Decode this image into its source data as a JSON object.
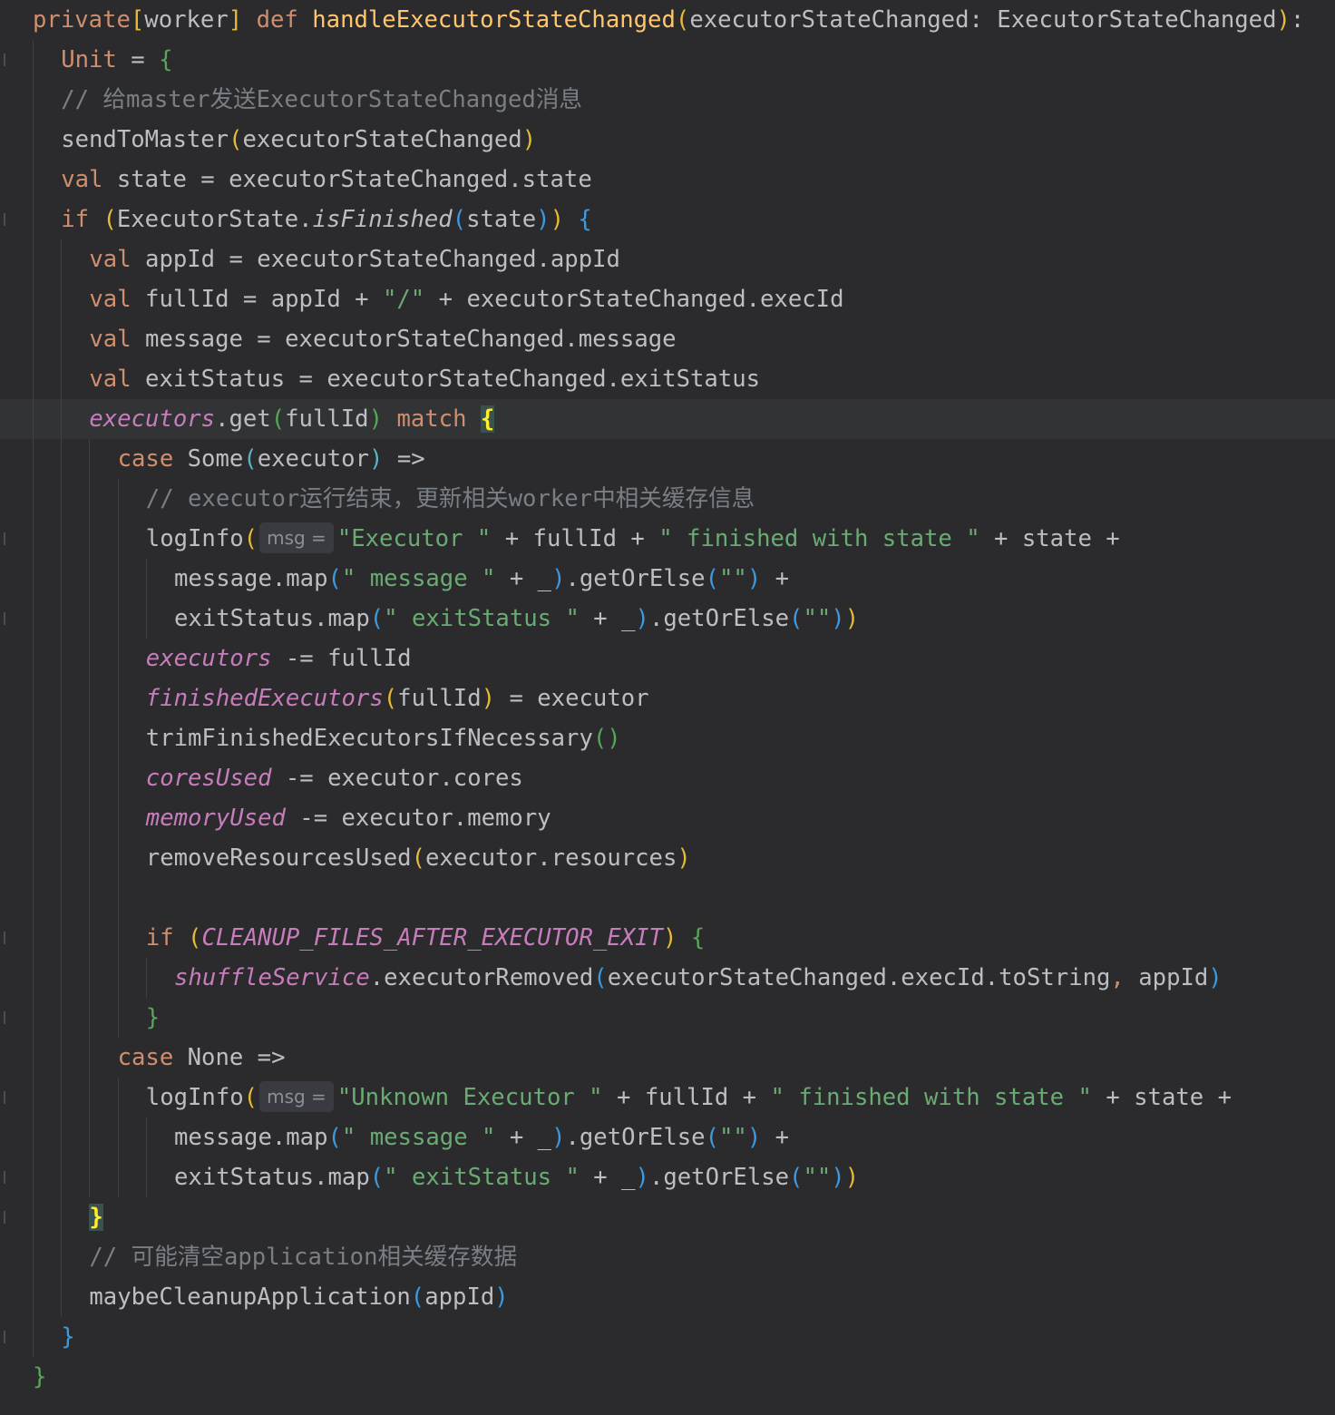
{
  "editor": {
    "colors": {
      "background": "#2b2b2d",
      "keyword": "#cf8e6d",
      "function_def": "#ffc66d",
      "function_call": "#56a8f5",
      "string": "#6aab73",
      "comment": "#7a7e85",
      "field": "#c77dbb",
      "default_text": "#bcbec4"
    },
    "lines": [
      {
        "indent": 1,
        "tokens": [
          [
            "kw",
            "private"
          ],
          [
            "br-y",
            "["
          ],
          [
            "plain",
            "worker"
          ],
          [
            "br-y",
            "]"
          ],
          [
            "plain",
            " "
          ],
          [
            "kw",
            "def"
          ],
          [
            "plain",
            " "
          ],
          [
            "fndef",
            "handleExecutorStateChanged"
          ],
          [
            "br-y",
            "("
          ],
          [
            "plain",
            "executorStateChanged: ExecutorStateChanged"
          ],
          [
            "br-y",
            ")"
          ],
          [
            "plain",
            ":"
          ]
        ]
      },
      {
        "indent": 2,
        "tokens": [
          [
            "kw",
            "Unit"
          ],
          [
            "plain",
            " = "
          ],
          [
            "br-g",
            "{"
          ]
        ]
      },
      {
        "indent": 2,
        "tokens": [
          [
            "cm",
            "// 给master发送ExecutorStateChanged消息"
          ]
        ]
      },
      {
        "indent": 2,
        "tokens": [
          [
            "plain",
            "sendToMaster"
          ],
          [
            "br-y",
            "("
          ],
          [
            "plain",
            "executorStateChanged"
          ],
          [
            "br-y",
            ")"
          ]
        ]
      },
      {
        "indent": 2,
        "tokens": [
          [
            "kw",
            "val"
          ],
          [
            "plain",
            " state = executorStateChanged.state"
          ]
        ]
      },
      {
        "indent": 2,
        "tokens": [
          [
            "kw",
            "if"
          ],
          [
            "plain",
            " "
          ],
          [
            "br-y",
            "("
          ],
          [
            "plain",
            "ExecutorState."
          ],
          [
            "it",
            "isFinished"
          ],
          [
            "br-b",
            "("
          ],
          [
            "plain",
            "state"
          ],
          [
            "br-b",
            ")"
          ],
          [
            "br-y",
            ")"
          ],
          [
            "plain",
            " "
          ],
          [
            "br-b",
            "{"
          ]
        ]
      },
      {
        "indent": 3,
        "tokens": [
          [
            "kw",
            "val"
          ],
          [
            "plain",
            " appId = executorStateChanged.appId"
          ]
        ]
      },
      {
        "indent": 3,
        "tokens": [
          [
            "kw",
            "val"
          ],
          [
            "plain",
            " fullId = appId + "
          ],
          [
            "str",
            "\"/\""
          ],
          [
            "plain",
            " + executorStateChanged.execId"
          ]
        ]
      },
      {
        "indent": 3,
        "tokens": [
          [
            "kw",
            "val"
          ],
          [
            "plain",
            " message = executorStateChanged.message"
          ]
        ]
      },
      {
        "indent": 3,
        "tokens": [
          [
            "kw",
            "val"
          ],
          [
            "plain",
            " exitStatus = executorStateChanged.exitStatus"
          ]
        ]
      },
      {
        "indent": 3,
        "current": true,
        "tokens": [
          [
            "field",
            "executors"
          ],
          [
            "plain",
            ".get"
          ],
          [
            "br-g",
            "("
          ],
          [
            "plain",
            "fullId"
          ],
          [
            "br-g",
            ")"
          ],
          [
            "plain",
            " "
          ],
          [
            "kw",
            "match"
          ],
          [
            "plain",
            " "
          ],
          [
            "br-hl",
            "{"
          ]
        ]
      },
      {
        "indent": 4,
        "tokens": [
          [
            "kw",
            "case"
          ],
          [
            "plain",
            " Some"
          ],
          [
            "br-t",
            "("
          ],
          [
            "plain",
            "executor"
          ],
          [
            "br-t",
            ")"
          ],
          [
            "plain",
            " =>"
          ]
        ]
      },
      {
        "indent": 5,
        "tokens": [
          [
            "cm",
            "// executor运行结束，更新相关worker中相关缓存信息"
          ]
        ]
      },
      {
        "indent": 5,
        "tokens": [
          [
            "plain",
            "logInfo"
          ],
          [
            "br-y",
            "("
          ],
          [
            "hint",
            "msg ="
          ],
          [
            "str",
            "\"Executor \""
          ],
          [
            "plain",
            " + fullId + "
          ],
          [
            "str",
            "\" finished with state \""
          ],
          [
            "plain",
            " + state +"
          ]
        ]
      },
      {
        "indent": 6,
        "tokens": [
          [
            "plain",
            "message.map"
          ],
          [
            "br-b",
            "("
          ],
          [
            "str",
            "\" message \""
          ],
          [
            "plain",
            " + _"
          ],
          [
            "br-b",
            ")"
          ],
          [
            "plain",
            ".getOrElse"
          ],
          [
            "br-b",
            "("
          ],
          [
            "str",
            "\"\""
          ],
          [
            "br-b",
            ")"
          ],
          [
            "plain",
            " +"
          ]
        ]
      },
      {
        "indent": 6,
        "tokens": [
          [
            "plain",
            "exitStatus.map"
          ],
          [
            "br-b",
            "("
          ],
          [
            "str",
            "\" exitStatus \""
          ],
          [
            "plain",
            " + _"
          ],
          [
            "br-b",
            ")"
          ],
          [
            "plain",
            ".getOrElse"
          ],
          [
            "br-b",
            "("
          ],
          [
            "str",
            "\"\""
          ],
          [
            "br-b",
            ")"
          ],
          [
            "br-y",
            ")"
          ]
        ]
      },
      {
        "indent": 5,
        "tokens": [
          [
            "field",
            "executors"
          ],
          [
            "plain",
            " -= fullId"
          ]
        ]
      },
      {
        "indent": 5,
        "tokens": [
          [
            "field",
            "finishedExecutors"
          ],
          [
            "br-y",
            "("
          ],
          [
            "plain",
            "fullId"
          ],
          [
            "br-y",
            ")"
          ],
          [
            "plain",
            " = executor"
          ]
        ]
      },
      {
        "indent": 5,
        "tokens": [
          [
            "plain",
            "trimFinishedExecutorsIfNecessary"
          ],
          [
            "br-g",
            "()"
          ]
        ]
      },
      {
        "indent": 5,
        "tokens": [
          [
            "field",
            "coresUsed"
          ],
          [
            "plain",
            " -= executor.cores"
          ]
        ]
      },
      {
        "indent": 5,
        "tokens": [
          [
            "field",
            "memoryUsed"
          ],
          [
            "plain",
            " -= executor.memory"
          ]
        ]
      },
      {
        "indent": 5,
        "tokens": [
          [
            "plain",
            "removeResourcesUsed"
          ],
          [
            "br-y",
            "("
          ],
          [
            "plain",
            "executor.resources"
          ],
          [
            "br-y",
            ")"
          ]
        ]
      },
      {
        "indent": 5,
        "tokens": []
      },
      {
        "indent": 5,
        "tokens": [
          [
            "kw",
            "if"
          ],
          [
            "plain",
            " "
          ],
          [
            "br-y",
            "("
          ],
          [
            "field",
            "CLEANUP_FILES_AFTER_EXECUTOR_EXIT"
          ],
          [
            "br-y",
            ")"
          ],
          [
            "plain",
            " "
          ],
          [
            "br-g",
            "{"
          ]
        ]
      },
      {
        "indent": 6,
        "tokens": [
          [
            "field",
            "shuffleService"
          ],
          [
            "plain",
            ".executorRemoved"
          ],
          [
            "br-b",
            "("
          ],
          [
            "plain",
            "executorStateChanged.execId.toString"
          ],
          [
            "kw",
            ","
          ],
          [
            "plain",
            " appId"
          ],
          [
            "br-b",
            ")"
          ]
        ]
      },
      {
        "indent": 5,
        "tokens": [
          [
            "br-g",
            "}"
          ]
        ]
      },
      {
        "indent": 4,
        "tokens": [
          [
            "kw",
            "case"
          ],
          [
            "plain",
            " None =>"
          ]
        ]
      },
      {
        "indent": 5,
        "tokens": [
          [
            "plain",
            "logInfo"
          ],
          [
            "br-y",
            "("
          ],
          [
            "hint",
            "msg ="
          ],
          [
            "str",
            "\"Unknown Executor \""
          ],
          [
            "plain",
            " + fullId + "
          ],
          [
            "str",
            "\" finished with state \""
          ],
          [
            "plain",
            " + state +"
          ]
        ]
      },
      {
        "indent": 6,
        "tokens": [
          [
            "plain",
            "message.map"
          ],
          [
            "br-b",
            "("
          ],
          [
            "str",
            "\" message \""
          ],
          [
            "plain",
            " + _"
          ],
          [
            "br-b",
            ")"
          ],
          [
            "plain",
            ".getOrElse"
          ],
          [
            "br-b",
            "("
          ],
          [
            "str",
            "\"\""
          ],
          [
            "br-b",
            ")"
          ],
          [
            "plain",
            " +"
          ]
        ]
      },
      {
        "indent": 6,
        "tokens": [
          [
            "plain",
            "exitStatus.map"
          ],
          [
            "br-b",
            "("
          ],
          [
            "str",
            "\" exitStatus \""
          ],
          [
            "plain",
            " + _"
          ],
          [
            "br-b",
            ")"
          ],
          [
            "plain",
            ".getOrElse"
          ],
          [
            "br-b",
            "("
          ],
          [
            "str",
            "\"\""
          ],
          [
            "br-b",
            ")"
          ],
          [
            "br-y",
            ")"
          ]
        ]
      },
      {
        "indent": 3,
        "tokens": [
          [
            "br-hl",
            "}"
          ]
        ]
      },
      {
        "indent": 3,
        "tokens": [
          [
            "cm",
            "// 可能清空application相关缓存数据"
          ]
        ]
      },
      {
        "indent": 3,
        "tokens": [
          [
            "plain",
            "maybeCleanupApplication"
          ],
          [
            "br-b",
            "("
          ],
          [
            "plain",
            "appId"
          ],
          [
            "br-b",
            ")"
          ]
        ]
      },
      {
        "indent": 2,
        "tokens": [
          [
            "br-b",
            "}"
          ]
        ]
      },
      {
        "indent": 1,
        "tokens": [
          [
            "br-g",
            "}"
          ]
        ]
      }
    ]
  }
}
